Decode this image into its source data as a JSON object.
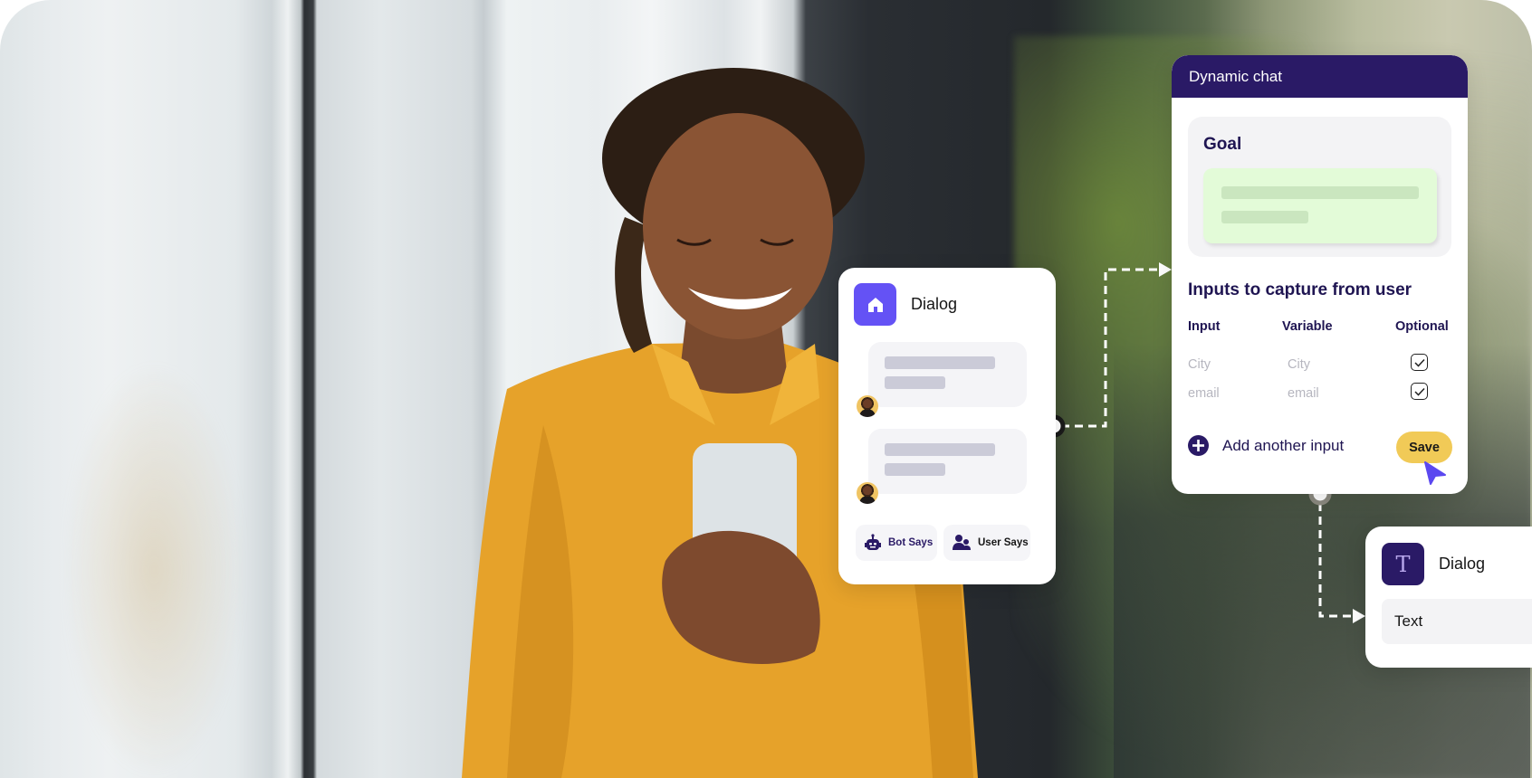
{
  "colors": {
    "navy": "#2a1a66",
    "accent_purple": "#6452f5",
    "save_yellow": "#f1ca57",
    "goal_green": "#e3fbd8",
    "cursor_purple": "#5b48f0"
  },
  "dialog_card": {
    "icon": "home-icon",
    "title": "Dialog",
    "bubbles": [
      {
        "avatar": "user-avatar"
      },
      {
        "avatar": "user-avatar"
      }
    ],
    "chips": [
      {
        "icon": "robot-icon",
        "label": "Bot Says"
      },
      {
        "icon": "users-icon",
        "label": "User Says"
      }
    ]
  },
  "dynamic_chat": {
    "header": "Dynamic chat",
    "goal_title": "Goal",
    "inputs_title": "Inputs to capture from user",
    "columns": [
      "Input",
      "Variable",
      "Optional"
    ],
    "rows": [
      {
        "input": "City",
        "variable": "City",
        "optional": true
      },
      {
        "input": "email",
        "variable": "email",
        "optional": true
      }
    ],
    "add_label": "Add another input",
    "save_label": "Save"
  },
  "dialog_card_2": {
    "icon": "text-icon",
    "icon_glyph": "T",
    "title": "Dialog",
    "field_value": "Text"
  }
}
